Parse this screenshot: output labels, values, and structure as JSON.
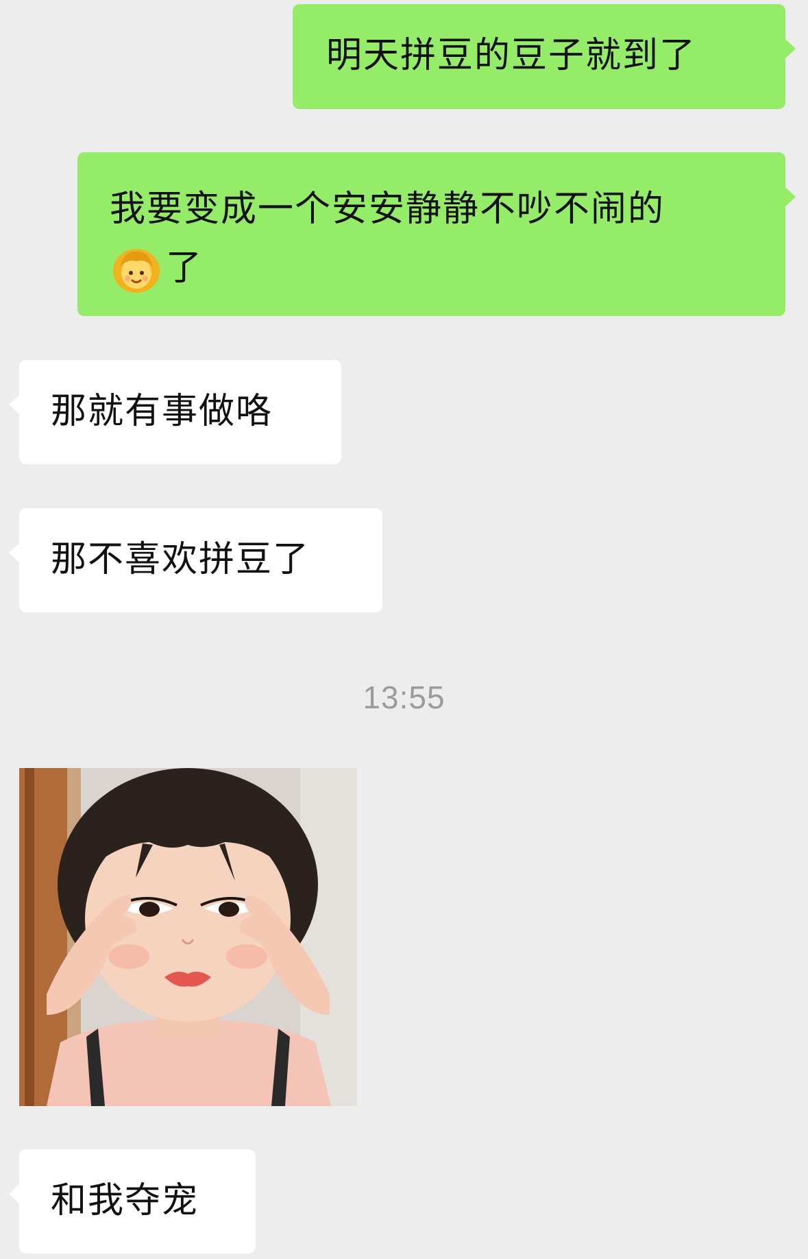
{
  "chat": {
    "messages": [
      {
        "id": 1,
        "side": "outgoing",
        "text": "明天拼豆的豆子就到了"
      },
      {
        "id": 2,
        "side": "outgoing",
        "line1": "我要变成一个安安静静不吵不闹的",
        "line2": "了",
        "emoji": "girl-emoji-icon"
      },
      {
        "id": 3,
        "side": "incoming",
        "text": "那就有事做咯"
      },
      {
        "id": 4,
        "side": "incoming",
        "text": "那不喜欢拼豆了"
      },
      {
        "id": 5,
        "side": "incoming",
        "type": "sticker",
        "sticker": "girl-pulling-eyes-sticker"
      },
      {
        "id": 6,
        "side": "incoming",
        "text": "和我夺宠"
      }
    ],
    "timestamp": "13:55"
  },
  "colors": {
    "background": "#ededed",
    "outgoing_bubble": "#95ec69",
    "incoming_bubble": "#ffffff",
    "text": "#111111",
    "timestamp": "#9b9b9b"
  }
}
